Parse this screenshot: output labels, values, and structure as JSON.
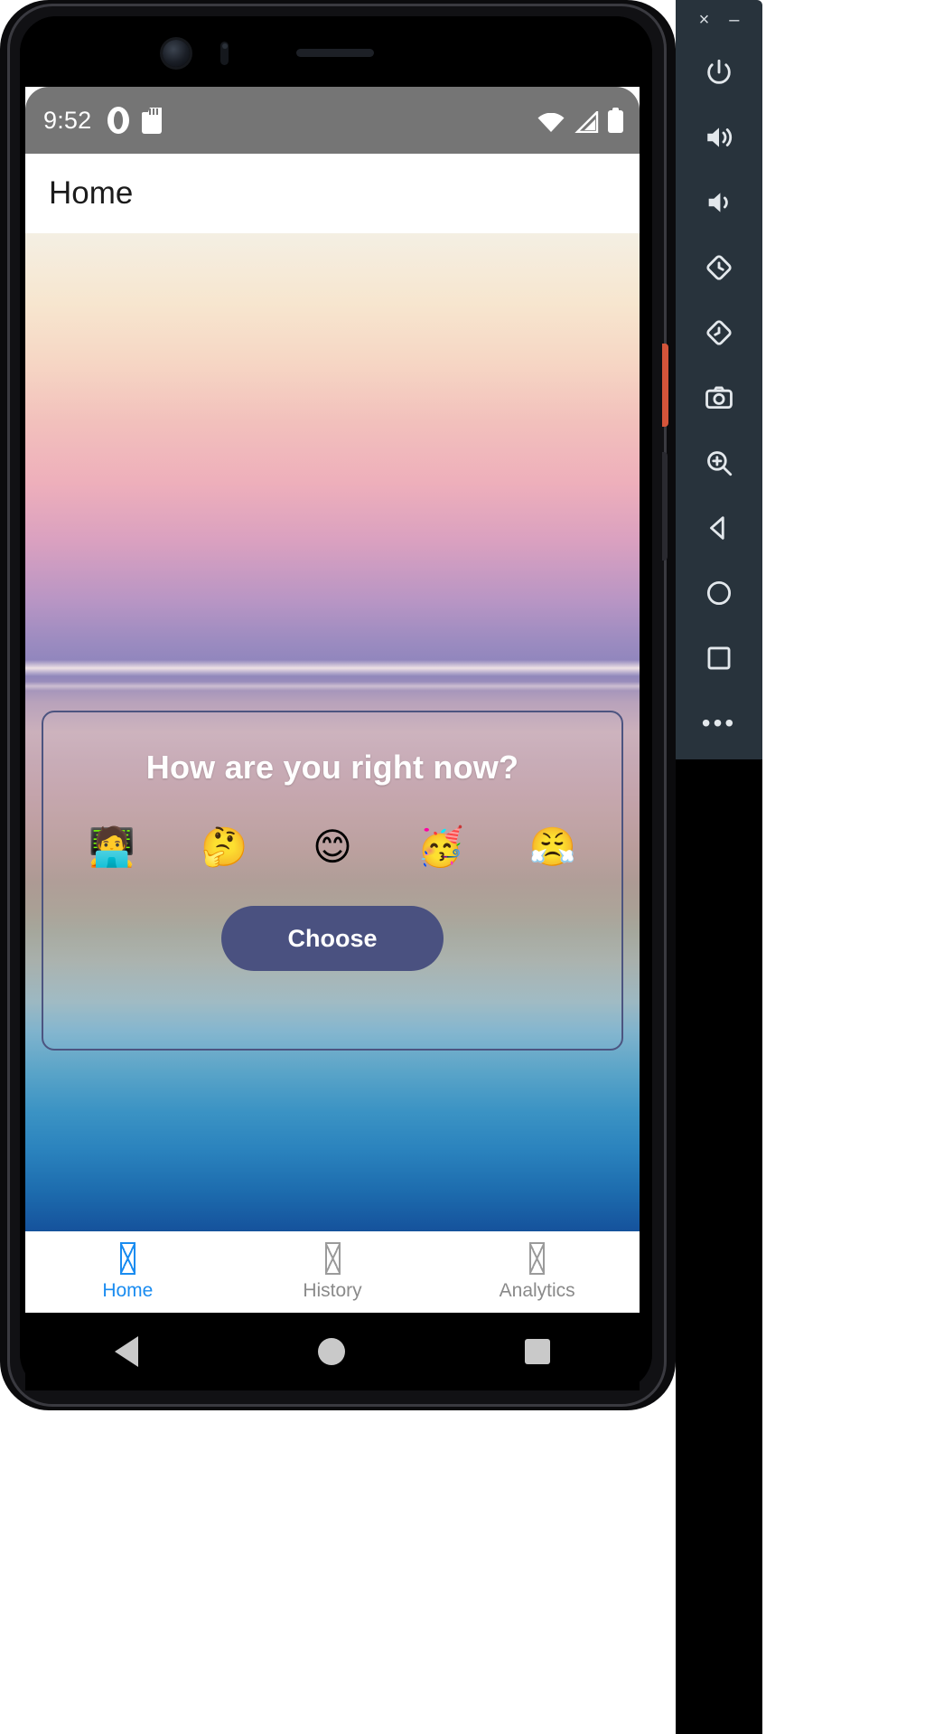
{
  "statusbar": {
    "time": "9:52",
    "icons": [
      "alarm-icon",
      "sd-card-icon",
      "wifi-icon",
      "cellular-signal-icon",
      "battery-icon"
    ]
  },
  "appbar": {
    "title": "Home"
  },
  "mood_card": {
    "title": "How are you right now?",
    "emojis": [
      {
        "name": "technologist-emoji",
        "glyph": "🧑‍💻",
        "label": "working"
      },
      {
        "name": "thinking-face-emoji",
        "glyph": "🤔",
        "label": "thinking"
      },
      {
        "name": "smiling-face-emoji",
        "glyph": "😊",
        "label": "happy"
      },
      {
        "name": "partying-face-emoji",
        "glyph": "🥳",
        "label": "celebrating"
      },
      {
        "name": "angry-crying-face-emoji",
        "glyph": "😤",
        "label": "frustrated"
      }
    ],
    "choose_label": "Choose"
  },
  "bottomnav": {
    "items": [
      {
        "label": "Home",
        "active": true
      },
      {
        "label": "History",
        "active": false
      },
      {
        "label": "Analytics",
        "active": false
      }
    ]
  },
  "sysnav": {
    "back": "back-button",
    "home": "home-button",
    "recents": "recents-button"
  },
  "emulator_toolbar": {
    "close": "×",
    "minimize": "–",
    "buttons": [
      "power-icon",
      "volume-up-icon",
      "volume-down-icon",
      "rotate-left-icon",
      "rotate-right-icon",
      "camera-icon",
      "zoom-icon",
      "back-icon",
      "home-icon",
      "overview-icon",
      "more-icon"
    ],
    "more": "•••"
  },
  "colors": {
    "accent": "#1a8cf0",
    "button": "#4a5180",
    "card_border": "#4c5480",
    "statusbar": "#757575",
    "toolbar_bg": "#28333c"
  }
}
